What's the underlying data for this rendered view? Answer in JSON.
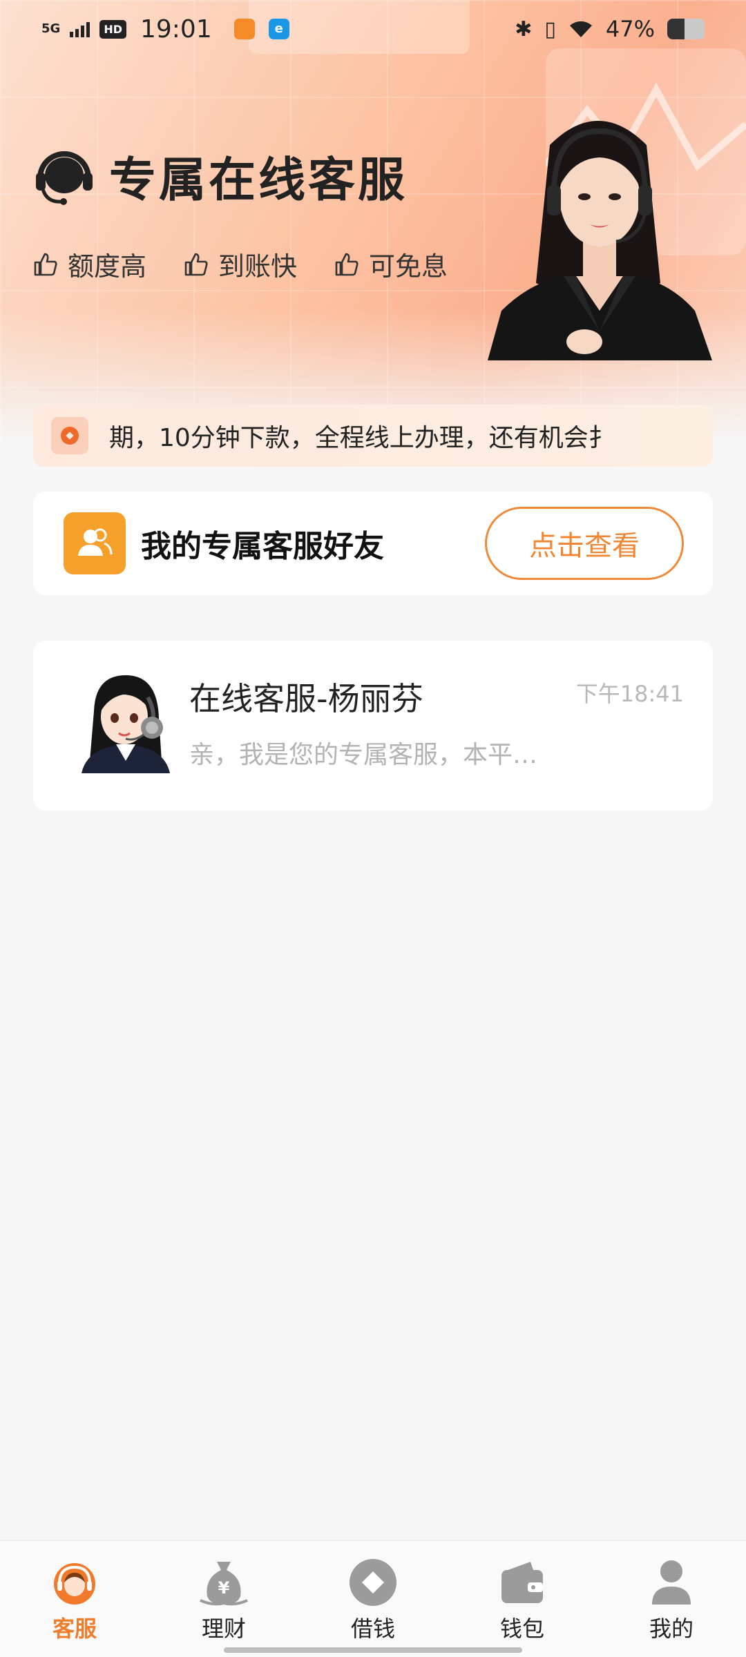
{
  "status_bar": {
    "network": "5G",
    "hd": "HD",
    "time": "19:01",
    "app2_label": "e",
    "battery": "47%"
  },
  "hero": {
    "title": "专属在线客服",
    "tags": [
      "额度高",
      "到账快",
      "可免息"
    ]
  },
  "notice": {
    "text": "期，10分钟下款，全程线上办理，还有机会扌"
  },
  "friend_card": {
    "title": "我的专属客服好友",
    "button": "点击查看"
  },
  "chat": {
    "name": "在线客服-杨丽芬",
    "time": "下午18:41",
    "preview": "亲，我是您的专属客服，本平…"
  },
  "nav": {
    "items": [
      {
        "label": "客服",
        "icon": "customer-service-icon",
        "active": true
      },
      {
        "label": "理财",
        "icon": "money-bag-icon",
        "active": false
      },
      {
        "label": "借钱",
        "icon": "borrow-icon",
        "active": false
      },
      {
        "label": "钱包",
        "icon": "wallet-icon",
        "active": false
      },
      {
        "label": "我的",
        "icon": "profile-icon",
        "active": false
      }
    ]
  },
  "colors": {
    "accent": "#ef7d2e",
    "friend_icon_bg": "#f7a12d",
    "hero_gradient": "#fcc3a3"
  }
}
